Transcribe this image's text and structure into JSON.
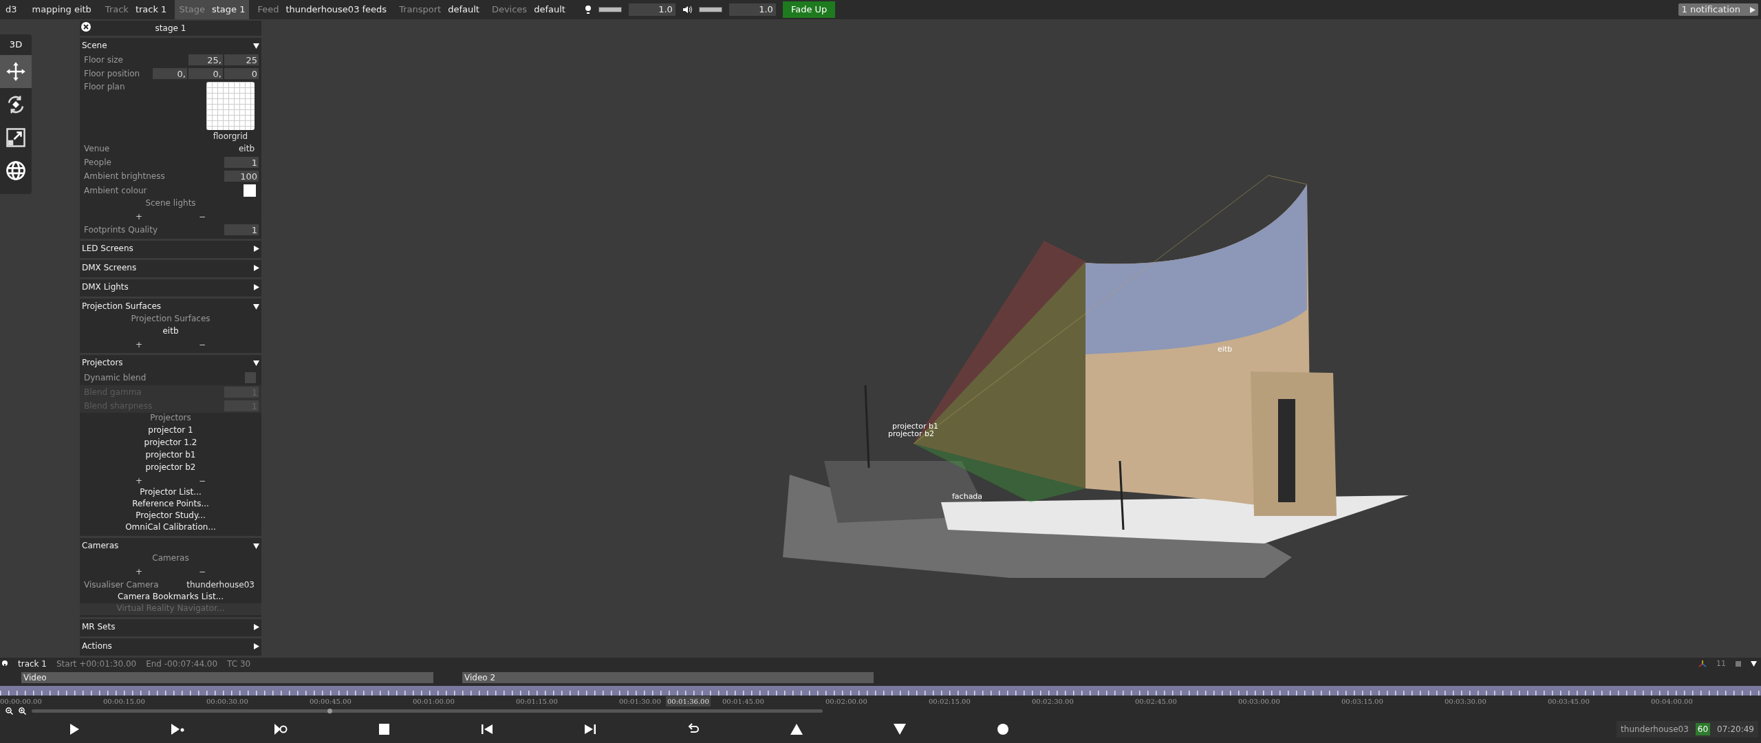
{
  "topbar": {
    "app": "d3",
    "project": "mapping eitb",
    "fields": [
      {
        "label": "Track",
        "value": "track 1",
        "selected": false
      },
      {
        "label": "Stage",
        "value": "stage 1",
        "selected": true
      },
      {
        "label": "Feed",
        "value": "thunderhouse03 feeds",
        "selected": false
      },
      {
        "label": "Transport",
        "value": "default",
        "selected": false
      },
      {
        "label": "Devices",
        "value": "default",
        "selected": false
      }
    ],
    "brightness": {
      "level": 1,
      "reading": "1.0"
    },
    "volume": {
      "level": 1,
      "reading": "1.0"
    },
    "fade_button": "Fade Up",
    "notification": "1 notification"
  },
  "toolbar": {
    "label": "3D",
    "tools": [
      {
        "kind": "move",
        "selected": true
      },
      {
        "kind": "rotate",
        "selected": false
      },
      {
        "kind": "scale",
        "selected": false
      },
      {
        "kind": "globe",
        "selected": false
      }
    ]
  },
  "panel": {
    "title": "stage 1",
    "sections": [
      {
        "title": "Scene",
        "expanded": true,
        "rows": [
          {
            "kind": "values",
            "label": "Floor size",
            "values": [
              "25,",
              "25"
            ]
          },
          {
            "kind": "values",
            "label": "Floor position",
            "values": [
              "0,",
              "0,",
              "0"
            ]
          },
          {
            "kind": "image",
            "label": "Floor plan",
            "caption": "floorgrid"
          },
          {
            "kind": "text",
            "label": "Venue",
            "value": "eitb"
          },
          {
            "kind": "values",
            "label": "People",
            "values": [
              "1"
            ]
          },
          {
            "kind": "values",
            "label": "Ambient brightness",
            "values": [
              "100"
            ]
          },
          {
            "kind": "color",
            "label": "Ambient colour",
            "color": "#ffffff"
          },
          {
            "kind": "heading",
            "text": "Scene lights"
          },
          {
            "kind": "addremove",
            "add": "+",
            "remove": "−"
          },
          {
            "kind": "values",
            "label": "Footprints Quality",
            "values": [
              "1"
            ]
          }
        ]
      },
      {
        "title": "LED Screens",
        "expanded": false
      },
      {
        "title": "DMX Screens",
        "expanded": false
      },
      {
        "title": "DMX Lights",
        "expanded": false
      },
      {
        "title": "Projection Surfaces",
        "expanded": true,
        "rows": [
          {
            "kind": "heading",
            "text": "Projection Surfaces"
          },
          {
            "kind": "item",
            "text": "eitb"
          },
          {
            "kind": "addremove",
            "add": "+",
            "remove": "−"
          }
        ]
      },
      {
        "title": "Projectors",
        "expanded": true,
        "rows": [
          {
            "kind": "checkbox",
            "label": "Dynamic blend",
            "checked": false
          },
          {
            "kind": "values",
            "label": "Blend gamma",
            "values": [
              "1"
            ],
            "disabled": true
          },
          {
            "kind": "values",
            "label": "Blend sharpness",
            "values": [
              "1"
            ],
            "disabled": true
          },
          {
            "kind": "heading",
            "text": "Projectors"
          },
          {
            "kind": "item",
            "text": "projector 1"
          },
          {
            "kind": "item",
            "text": "projector 1.2"
          },
          {
            "kind": "item",
            "text": "projector b1"
          },
          {
            "kind": "item",
            "text": "projector b2"
          },
          {
            "kind": "addremove",
            "add": "+",
            "remove": "−"
          },
          {
            "kind": "link",
            "text": "Projector List..."
          },
          {
            "kind": "link",
            "text": "Reference Points..."
          },
          {
            "kind": "link",
            "text": "Projector Study..."
          },
          {
            "kind": "link",
            "text": "OmniCal Calibration..."
          }
        ]
      },
      {
        "title": "Cameras",
        "expanded": true,
        "rows": [
          {
            "kind": "heading",
            "text": "Cameras"
          },
          {
            "kind": "addremove",
            "add": "+",
            "remove": "−"
          },
          {
            "kind": "text",
            "label": "Visualiser Camera",
            "value": "thunderhouse03"
          },
          {
            "kind": "link",
            "text": "Camera Bookmarks List..."
          },
          {
            "kind": "link",
            "text": "Virtual Reality Navigator...",
            "disabled": true
          }
        ]
      },
      {
        "title": "MR Sets",
        "expanded": false
      },
      {
        "title": "Actions",
        "expanded": false
      }
    ]
  },
  "viewport": {
    "labels": [
      {
        "text": "projector b1"
      },
      {
        "text": "projector b2"
      },
      {
        "text": "eitb"
      },
      {
        "text": "fachada"
      }
    ]
  },
  "timeline": {
    "track": "track 1",
    "info": [
      "Start +00:01:30.00",
      "End -00:07:44.00",
      "TC 30"
    ],
    "layer_count": "11",
    "clips": [
      {
        "label": "Video"
      },
      {
        "label": "Video 2"
      }
    ],
    "ticks": [
      "00:00:00.00",
      "00:00:15.00",
      "00:00:30.00",
      "00:00:45.00",
      "00:01:00.00",
      "00:01:15.00",
      "00:01:30.00",
      "00:01:45.00",
      "00:02:00.00",
      "00:02:15.00",
      "00:02:30.00",
      "00:02:45.00",
      "00:03:00.00",
      "00:03:15.00",
      "00:03:30.00",
      "00:03:45.00",
      "00:04:00.00"
    ],
    "playhead": "00:01:36.00",
    "transport": [
      {
        "kind": "play"
      },
      {
        "kind": "play-section"
      },
      {
        "kind": "loop"
      },
      {
        "kind": "stop"
      },
      {
        "kind": "previous"
      },
      {
        "kind": "next"
      },
      {
        "kind": "return"
      },
      {
        "kind": "up"
      },
      {
        "kind": "down"
      },
      {
        "kind": "record"
      }
    ],
    "status": {
      "machine": "thunderhouse03",
      "fps": "60",
      "clock": "07:20:49"
    }
  }
}
